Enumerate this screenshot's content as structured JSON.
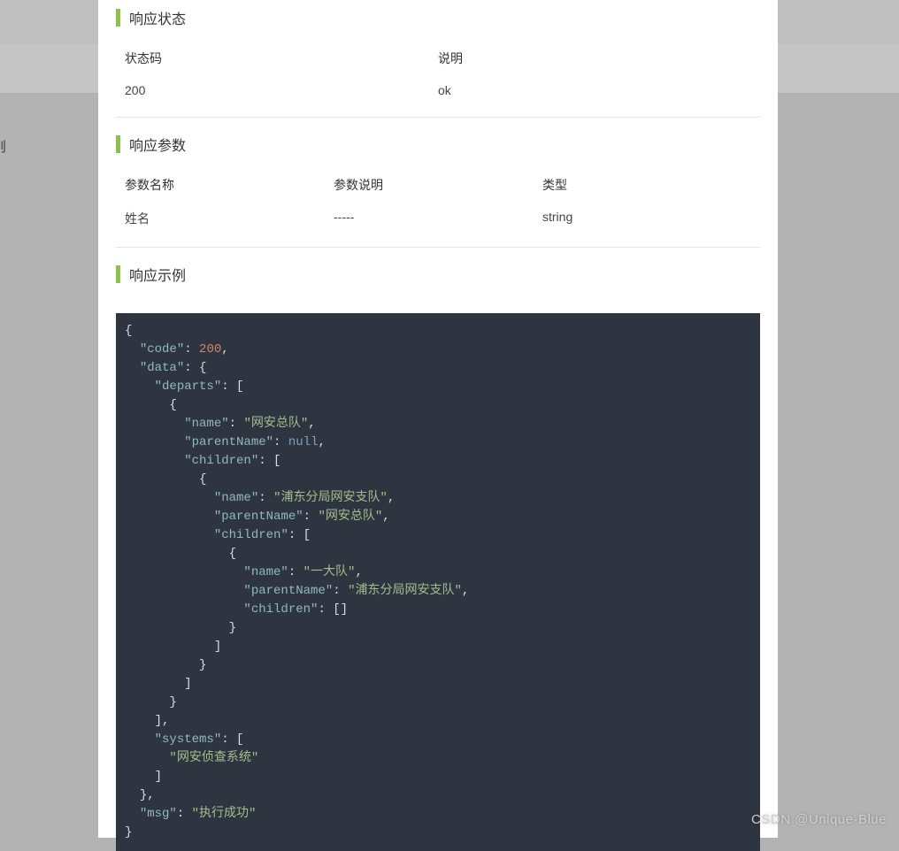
{
  "background": {
    "sidebar_text": "则"
  },
  "sections": {
    "status": {
      "title": "响应状态",
      "headers": {
        "code": "状态码",
        "desc": "说明"
      },
      "row": {
        "code": "200",
        "desc": "ok"
      }
    },
    "params": {
      "title": "响应参数",
      "headers": {
        "name": "参数名称",
        "desc": "参数说明",
        "type": "类型"
      },
      "row": {
        "name": "姓名",
        "desc": "-----",
        "type": "string"
      }
    },
    "example": {
      "title": "响应示例"
    }
  },
  "code_example": {
    "code": 200,
    "data": {
      "departs": [
        {
          "name": "网安总队",
          "parentName": null,
          "children": [
            {
              "name": "浦东分局网安支队",
              "parentName": "网安总队",
              "children": [
                {
                  "name": "一大队",
                  "parentName": "浦东分局网安支队",
                  "children": []
                }
              ]
            }
          ]
        }
      ],
      "systems": [
        "网安侦查系统"
      ]
    },
    "msg": "执行成功"
  },
  "watermark": "CSDN @Unique·Blue"
}
